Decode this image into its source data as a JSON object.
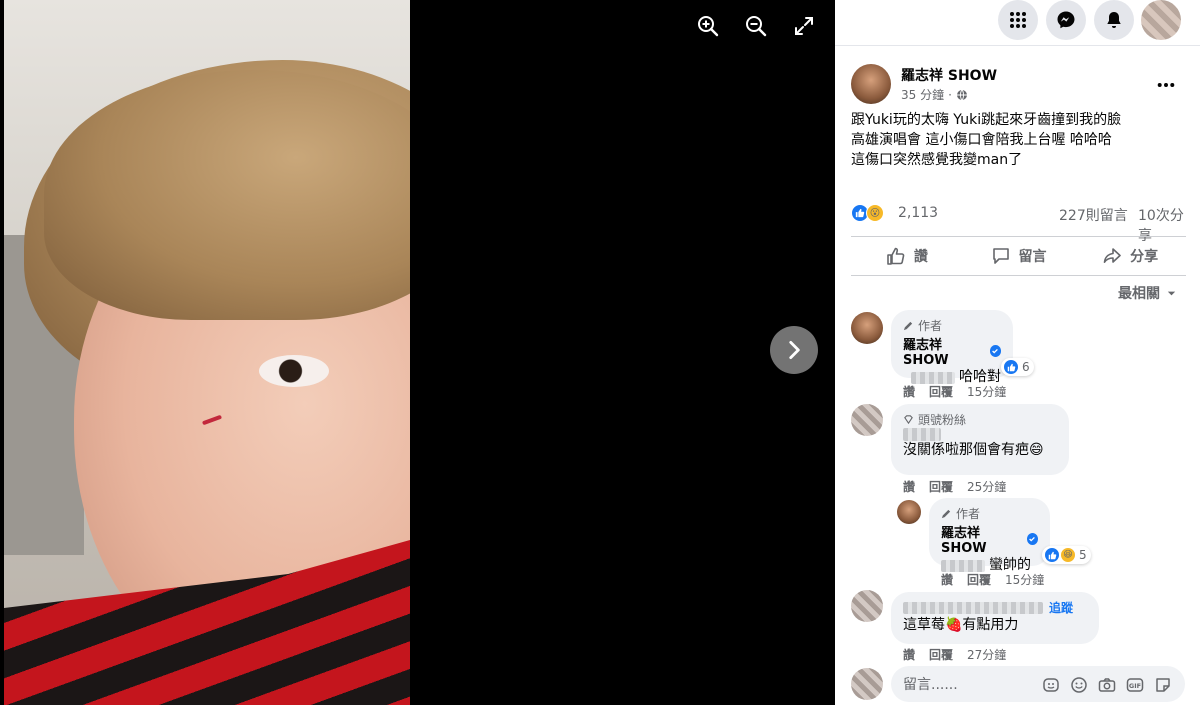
{
  "colors": {
    "brand": "#1877f2",
    "secondary_text": "#65676b",
    "bubble": "#f0f2f5"
  },
  "viewer": {
    "tools": [
      {
        "name": "zoom-in",
        "icon": "zoom-in-icon"
      },
      {
        "name": "zoom-out",
        "icon": "zoom-out-icon"
      },
      {
        "name": "fullscreen",
        "icon": "expand-icon"
      }
    ],
    "next_icon": "chevron-right-icon"
  },
  "topbar": {
    "icons": [
      "menu-grid-icon",
      "messenger-icon",
      "notifications-bell-icon"
    ]
  },
  "post": {
    "author": "羅志祥 SHOW",
    "time": "35 分鐘",
    "separator": "·",
    "audience_icon": "globe-icon",
    "lines": [
      "跟Yuki玩的太嗨 Yuki跳起來牙齒撞到我的臉",
      "高雄演唱會 這小傷口會陪我上台喔 哈哈哈",
      "這傷口突然感覺我變man了"
    ],
    "reactions": {
      "count": "2,113",
      "types": [
        "like",
        "wow"
      ]
    },
    "comments_count": "227則留言",
    "shares_count": "10次分享"
  },
  "actions": {
    "like": "讚",
    "comment": "留言",
    "share": "分享"
  },
  "sort": "最相關",
  "comments": [
    {
      "badge": "作者",
      "name": "羅志祥 SHOW",
      "verified": true,
      "text": "哈哈對",
      "reaction_count": "6",
      "like": "讚",
      "reply": "回覆",
      "time": "15分鐘"
    },
    {
      "badge": "頭號粉絲",
      "text": "沒關係啦那個會有疤😄",
      "like": "讚",
      "reply": "回覆",
      "time": "25分鐘"
    },
    {
      "badge": "作者",
      "name": "羅志祥 SHOW",
      "verified": true,
      "text": "蠻帥的",
      "reaction_count": "5",
      "like": "讚",
      "reply": "回覆",
      "time": "15分鐘"
    },
    {
      "follow": "追蹤",
      "text": "這草莓🍓有點用力",
      "like": "讚",
      "reply": "回覆",
      "time": "27分鐘"
    }
  ],
  "composer": {
    "placeholder": "留言......",
    "icons": [
      "sticker-avatar-icon",
      "emoji-icon",
      "camera-icon",
      "gif-icon",
      "sticker-icon"
    ]
  }
}
